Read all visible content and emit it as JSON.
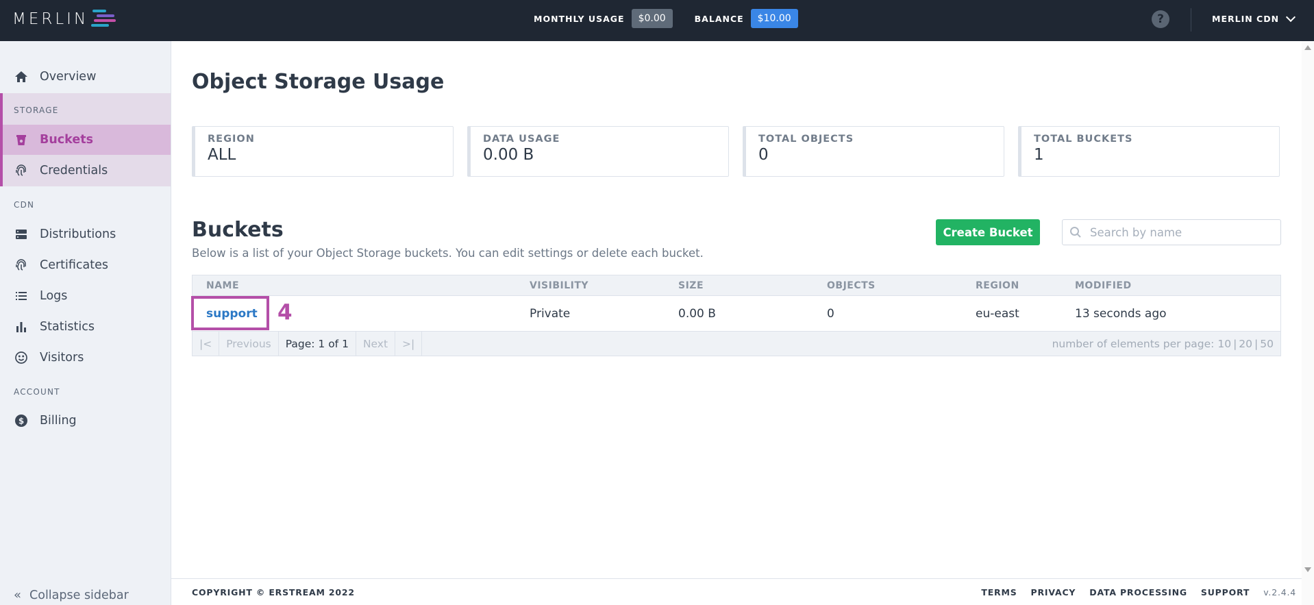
{
  "brand": {
    "logo_text": "MERLIN",
    "logo_colors": [
      "#2aa4c9",
      "#7a5ec9",
      "#c34fa8"
    ]
  },
  "header": {
    "monthly_usage_label": "MONTHLY USAGE",
    "monthly_usage_value": "$0.00",
    "balance_label": "BALANCE",
    "balance_value": "$10.00",
    "account_name": "MERLIN CDN",
    "help_icon": "question-circle-icon"
  },
  "sidebar": {
    "overview": {
      "label": "Overview",
      "icon": "home-icon"
    },
    "storage_section": "STORAGE",
    "buckets": {
      "label": "Buckets",
      "icon": "bucket-icon",
      "active": true
    },
    "credentials": {
      "label": "Credentials",
      "icon": "fingerprint-icon"
    },
    "cdn_section": "CDN",
    "distributions": {
      "label": "Distributions",
      "icon": "server-icon"
    },
    "certificates": {
      "label": "Certificates",
      "icon": "fingerprint-icon"
    },
    "logs": {
      "label": "Logs",
      "icon": "list-icon"
    },
    "statistics": {
      "label": "Statistics",
      "icon": "bar-chart-icon"
    },
    "visitors": {
      "label": "Visitors",
      "icon": "smiley-icon"
    },
    "account_section": "ACCOUNT",
    "billing": {
      "label": "Billing",
      "icon": "dollar-circle-icon"
    },
    "collapse_label": "Collapse sidebar",
    "accent_color": "#b44fa8"
  },
  "usage": {
    "title": "Object Storage Usage",
    "cards": [
      {
        "label": "REGION",
        "value": "ALL"
      },
      {
        "label": "DATA USAGE",
        "value": "0.00 B"
      },
      {
        "label": "TOTAL OBJECTS",
        "value": "0"
      },
      {
        "label": "TOTAL BUCKETS",
        "value": "1"
      }
    ]
  },
  "buckets": {
    "title": "Buckets",
    "subtitle": "Below is a list of your Object Storage buckets. You can edit settings or delete each bucket.",
    "create_label": "Create Bucket",
    "search_placeholder": "Search by name",
    "columns": [
      "NAME",
      "VISIBILITY",
      "SIZE",
      "OBJECTS",
      "REGION",
      "MODIFIED"
    ],
    "rows": [
      {
        "name": "support",
        "visibility": "Private",
        "size": "0.00 B",
        "objects": "0",
        "region": "eu-east",
        "modified": "13 seconds ago"
      }
    ],
    "annotation": "4",
    "pagination": {
      "first": "|<",
      "previous": "Previous",
      "page_info": "Page: 1 of 1",
      "next": "Next",
      "last": ">|",
      "per_page_label": "number of elements per page:",
      "per_page_options": [
        "10",
        "20",
        "50"
      ]
    }
  },
  "footer": {
    "copyright": "COPYRIGHT © ERSTREAM 2022",
    "links": [
      "TERMS",
      "PRIVACY",
      "DATA PROCESSING",
      "SUPPORT"
    ],
    "version": "v.2.4.4"
  }
}
